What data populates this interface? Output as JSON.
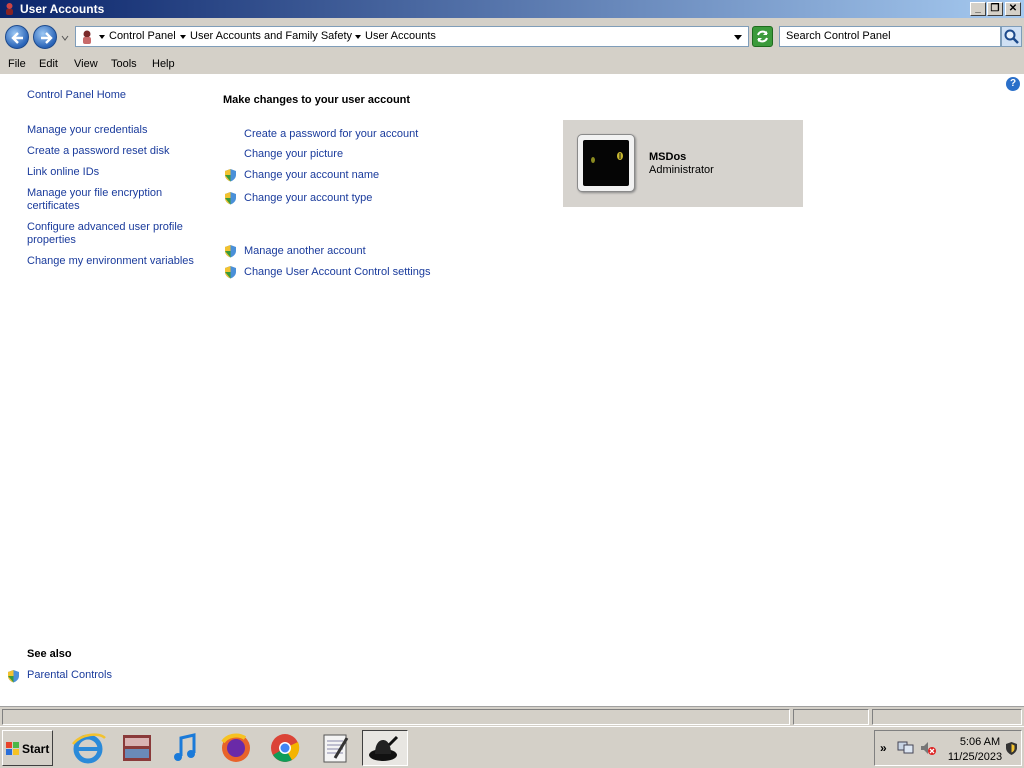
{
  "window": {
    "title": "User Accounts"
  },
  "title_buttons": {
    "minimize": "_",
    "restore": "❐",
    "close": "✕"
  },
  "breadcrumbs": [
    "Control Panel",
    "User Accounts and Family Safety",
    "User Accounts"
  ],
  "search": {
    "placeholder": "Search Control Panel"
  },
  "menu": [
    "File",
    "Edit",
    "View",
    "Tools",
    "Help"
  ],
  "help_glyph": "?",
  "sidebar": {
    "home": "Control Panel Home",
    "links": [
      "Manage your credentials",
      "Create a password reset disk",
      "Link online IDs",
      "Manage your file encryption certificates",
      "Configure advanced user profile properties",
      "Change my environment variables"
    ],
    "see_also_heading": "See also",
    "see_also_links": [
      "Parental Controls"
    ]
  },
  "main": {
    "heading": "Make changes to your user account",
    "tasks": [
      "Create a password for your account",
      "Change your picture",
      "Change your account name",
      "Change your account type"
    ],
    "other_tasks": [
      "Manage another account",
      "Change User Account Control settings"
    ]
  },
  "user": {
    "name": "MSDos",
    "role": "Administrator"
  },
  "taskbar": {
    "start_label": "Start",
    "apps": [
      "internet-explorer-icon",
      "media-center-icon",
      "itunes-icon",
      "firefox-icon",
      "chrome-icon",
      "notepad-icon",
      "black-hat-icon"
    ],
    "clock_time": "5:06 AM",
    "clock_date": "11/25/2023",
    "tray_expander": "»"
  },
  "colors": {
    "link": "#1a3b9c",
    "titlebar_start": "#0a246a",
    "titlebar_end": "#a6caf0"
  }
}
